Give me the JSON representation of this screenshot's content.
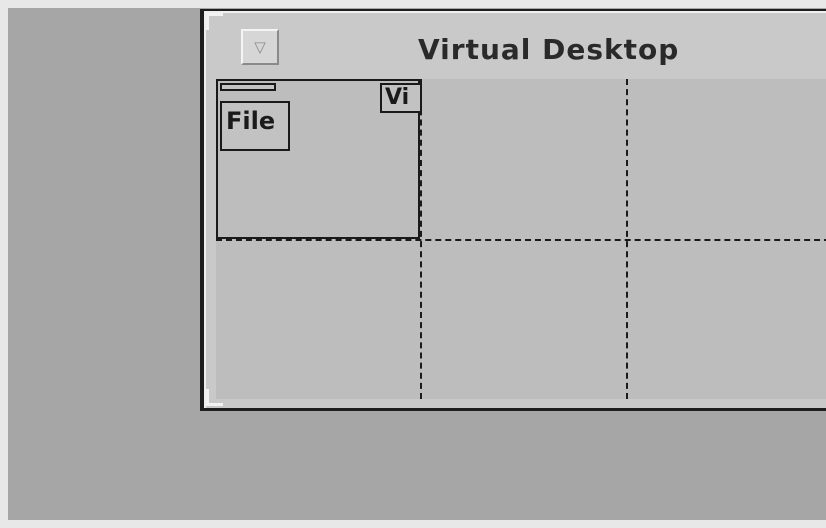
{
  "window": {
    "title": "Virtual Desktop",
    "menu_button_icon": "window-menu-icon",
    "menu_button_glyph": "▽"
  },
  "pager": {
    "columns": 3,
    "rows": 2,
    "mini_windows": [
      {
        "label": ""
      },
      {
        "label": "File"
      },
      {
        "label": "Vi"
      }
    ]
  },
  "colors": {
    "desktop_background": "#a6a6a6",
    "window_background": "#c9c9c9",
    "pager_background": "#bdbdbd",
    "frame_dark": "#1e1e1e"
  }
}
